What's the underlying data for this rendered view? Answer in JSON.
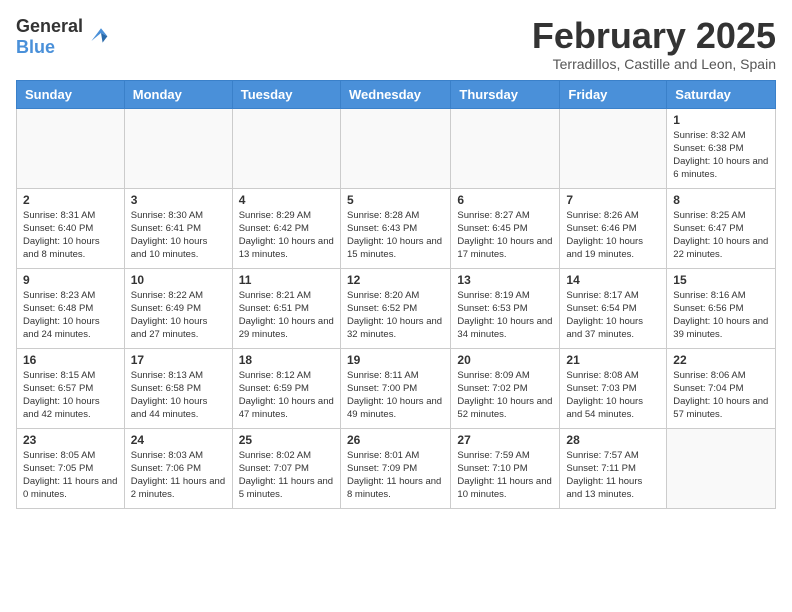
{
  "header": {
    "logo_general": "General",
    "logo_blue": "Blue",
    "month_year": "February 2025",
    "location": "Terradillos, Castille and Leon, Spain"
  },
  "days_of_week": [
    "Sunday",
    "Monday",
    "Tuesday",
    "Wednesday",
    "Thursday",
    "Friday",
    "Saturday"
  ],
  "weeks": [
    {
      "days": [
        {
          "date": "",
          "info": ""
        },
        {
          "date": "",
          "info": ""
        },
        {
          "date": "",
          "info": ""
        },
        {
          "date": "",
          "info": ""
        },
        {
          "date": "",
          "info": ""
        },
        {
          "date": "",
          "info": ""
        },
        {
          "date": "1",
          "info": "Sunrise: 8:32 AM\nSunset: 6:38 PM\nDaylight: 10 hours and 6 minutes."
        }
      ]
    },
    {
      "days": [
        {
          "date": "2",
          "info": "Sunrise: 8:31 AM\nSunset: 6:40 PM\nDaylight: 10 hours and 8 minutes."
        },
        {
          "date": "3",
          "info": "Sunrise: 8:30 AM\nSunset: 6:41 PM\nDaylight: 10 hours and 10 minutes."
        },
        {
          "date": "4",
          "info": "Sunrise: 8:29 AM\nSunset: 6:42 PM\nDaylight: 10 hours and 13 minutes."
        },
        {
          "date": "5",
          "info": "Sunrise: 8:28 AM\nSunset: 6:43 PM\nDaylight: 10 hours and 15 minutes."
        },
        {
          "date": "6",
          "info": "Sunrise: 8:27 AM\nSunset: 6:45 PM\nDaylight: 10 hours and 17 minutes."
        },
        {
          "date": "7",
          "info": "Sunrise: 8:26 AM\nSunset: 6:46 PM\nDaylight: 10 hours and 19 minutes."
        },
        {
          "date": "8",
          "info": "Sunrise: 8:25 AM\nSunset: 6:47 PM\nDaylight: 10 hours and 22 minutes."
        }
      ]
    },
    {
      "days": [
        {
          "date": "9",
          "info": "Sunrise: 8:23 AM\nSunset: 6:48 PM\nDaylight: 10 hours and 24 minutes."
        },
        {
          "date": "10",
          "info": "Sunrise: 8:22 AM\nSunset: 6:49 PM\nDaylight: 10 hours and 27 minutes."
        },
        {
          "date": "11",
          "info": "Sunrise: 8:21 AM\nSunset: 6:51 PM\nDaylight: 10 hours and 29 minutes."
        },
        {
          "date": "12",
          "info": "Sunrise: 8:20 AM\nSunset: 6:52 PM\nDaylight: 10 hours and 32 minutes."
        },
        {
          "date": "13",
          "info": "Sunrise: 8:19 AM\nSunset: 6:53 PM\nDaylight: 10 hours and 34 minutes."
        },
        {
          "date": "14",
          "info": "Sunrise: 8:17 AM\nSunset: 6:54 PM\nDaylight: 10 hours and 37 minutes."
        },
        {
          "date": "15",
          "info": "Sunrise: 8:16 AM\nSunset: 6:56 PM\nDaylight: 10 hours and 39 minutes."
        }
      ]
    },
    {
      "days": [
        {
          "date": "16",
          "info": "Sunrise: 8:15 AM\nSunset: 6:57 PM\nDaylight: 10 hours and 42 minutes."
        },
        {
          "date": "17",
          "info": "Sunrise: 8:13 AM\nSunset: 6:58 PM\nDaylight: 10 hours and 44 minutes."
        },
        {
          "date": "18",
          "info": "Sunrise: 8:12 AM\nSunset: 6:59 PM\nDaylight: 10 hours and 47 minutes."
        },
        {
          "date": "19",
          "info": "Sunrise: 8:11 AM\nSunset: 7:00 PM\nDaylight: 10 hours and 49 minutes."
        },
        {
          "date": "20",
          "info": "Sunrise: 8:09 AM\nSunset: 7:02 PM\nDaylight: 10 hours and 52 minutes."
        },
        {
          "date": "21",
          "info": "Sunrise: 8:08 AM\nSunset: 7:03 PM\nDaylight: 10 hours and 54 minutes."
        },
        {
          "date": "22",
          "info": "Sunrise: 8:06 AM\nSunset: 7:04 PM\nDaylight: 10 hours and 57 minutes."
        }
      ]
    },
    {
      "days": [
        {
          "date": "23",
          "info": "Sunrise: 8:05 AM\nSunset: 7:05 PM\nDaylight: 11 hours and 0 minutes."
        },
        {
          "date": "24",
          "info": "Sunrise: 8:03 AM\nSunset: 7:06 PM\nDaylight: 11 hours and 2 minutes."
        },
        {
          "date": "25",
          "info": "Sunrise: 8:02 AM\nSunset: 7:07 PM\nDaylight: 11 hours and 5 minutes."
        },
        {
          "date": "26",
          "info": "Sunrise: 8:01 AM\nSunset: 7:09 PM\nDaylight: 11 hours and 8 minutes."
        },
        {
          "date": "27",
          "info": "Sunrise: 7:59 AM\nSunset: 7:10 PM\nDaylight: 11 hours and 10 minutes."
        },
        {
          "date": "28",
          "info": "Sunrise: 7:57 AM\nSunset: 7:11 PM\nDaylight: 11 hours and 13 minutes."
        },
        {
          "date": "",
          "info": ""
        }
      ]
    }
  ]
}
